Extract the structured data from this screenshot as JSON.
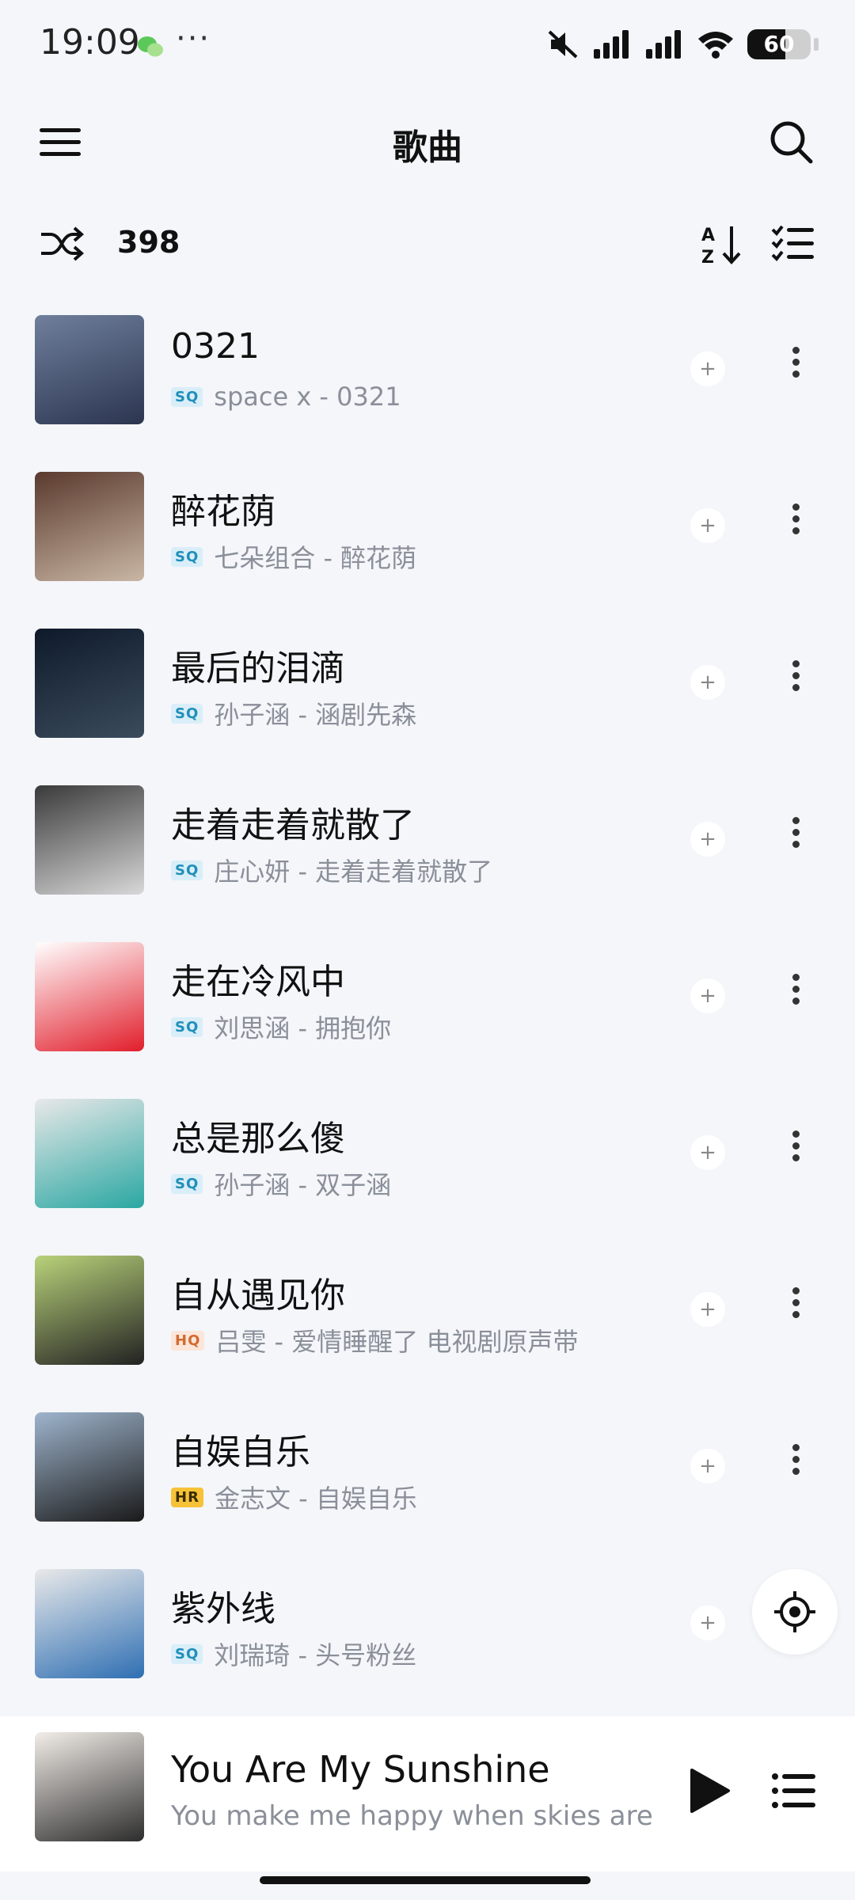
{
  "status_bar": {
    "time": "19:09",
    "more": "···",
    "battery": 60,
    "battery_label": "60",
    "icons": [
      "wechat-icon",
      "mute-icon",
      "signal-icon",
      "signal-icon",
      "wifi-icon",
      "battery-icon"
    ]
  },
  "header": {
    "title": "歌曲",
    "menu_icon": "hamburger-menu-icon",
    "search_icon": "search-icon"
  },
  "toolbar": {
    "count": "398",
    "shuffle_icon": "shuffle-icon",
    "sort_icon": "sort-az-icon",
    "multiselect_icon": "multi-select-icon"
  },
  "songs": [
    {
      "title": "0321",
      "quality": "SQ",
      "artist_album": "space x - 0321",
      "cover_colors": [
        "#6f7f9c",
        "#2b3550"
      ]
    },
    {
      "title": "醉花荫",
      "quality": "SQ",
      "artist_album": "七朵组合 - 醉花荫",
      "cover_colors": [
        "#5a3a2e",
        "#c9b6a4"
      ]
    },
    {
      "title": "最后的泪滴",
      "quality": "SQ",
      "artist_album": "孙子涵 - 涵剧先森",
      "cover_colors": [
        "#0e1a2a",
        "#3b4b5c"
      ]
    },
    {
      "title": "走着走着就散了",
      "quality": "SQ",
      "artist_album": "庄心妍 - 走着走着就散了",
      "cover_colors": [
        "#3a3a3a",
        "#d8d8d8"
      ]
    },
    {
      "title": "走在冷风中",
      "quality": "SQ",
      "artist_album": "刘思涵 - 拥抱你",
      "cover_colors": [
        "#ffffff",
        "#e11e2b"
      ]
    },
    {
      "title": "总是那么傻",
      "quality": "SQ",
      "artist_album": "孙子涵 - 双子涵",
      "cover_colors": [
        "#e8e8e8",
        "#2aa7a2"
      ]
    },
    {
      "title": "自从遇见你",
      "quality": "HQ",
      "artist_album": "吕雯 - 爱情睡醒了 电视剧原声带",
      "cover_colors": [
        "#b9d27a",
        "#222222"
      ]
    },
    {
      "title": "自娱自乐",
      "quality": "HR",
      "artist_album": "金志文 - 自娱自乐",
      "cover_colors": [
        "#9eb4cc",
        "#1a1a1a"
      ]
    },
    {
      "title": "紫外线",
      "quality": "SQ",
      "artist_album": "刘瑞琦 - 头号粉丝",
      "cover_colors": [
        "#e9e9e9",
        "#2f6fb3"
      ]
    }
  ],
  "locate_icon": "locate-crosshair-icon",
  "now_playing": {
    "title": "You Are My Sunshine",
    "lyric": "You make me happy when skies are",
    "play_icon": "play-icon",
    "queue_icon": "playlist-queue-icon",
    "cover_colors": [
      "#f2ede8",
      "#2d2d2d"
    ]
  }
}
